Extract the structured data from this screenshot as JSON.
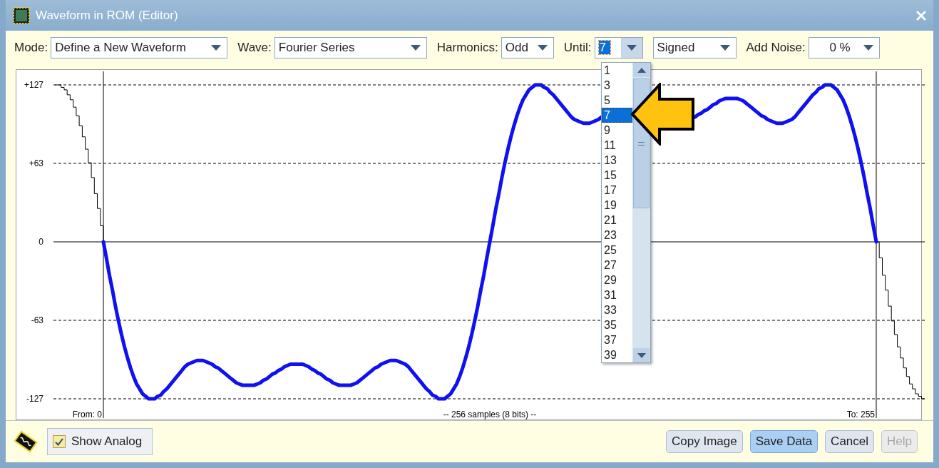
{
  "window": {
    "title": "Waveform in ROM (Editor)"
  },
  "toolbar": {
    "fields": [
      {
        "label": "Mode:",
        "value": "Define a New Waveform",
        "focused": false
      },
      {
        "label": "Wave:",
        "value": "Fourier Series",
        "focused": false
      },
      {
        "label": "Harmonics:",
        "value": "Odd",
        "focused": false
      },
      {
        "label": "Until:",
        "value": "7",
        "focused": true,
        "options": [
          {
            "label": "1",
            "selected": false
          },
          {
            "label": "3",
            "selected": false
          },
          {
            "label": "5",
            "selected": false
          },
          {
            "label": "7",
            "selected": true
          },
          {
            "label": "9",
            "selected": false
          },
          {
            "label": "11",
            "selected": false
          },
          {
            "label": "13",
            "selected": false
          },
          {
            "label": "15",
            "selected": false
          },
          {
            "label": "17",
            "selected": false
          },
          {
            "label": "19",
            "selected": false
          },
          {
            "label": "21",
            "selected": false
          },
          {
            "label": "23",
            "selected": false
          },
          {
            "label": "25",
            "selected": false
          },
          {
            "label": "27",
            "selected": false
          },
          {
            "label": "29",
            "selected": false
          },
          {
            "label": "31",
            "selected": false
          },
          {
            "label": "33",
            "selected": false
          },
          {
            "label": "35",
            "selected": false
          },
          {
            "label": "37",
            "selected": false
          },
          {
            "label": "39",
            "selected": false
          }
        ]
      },
      {
        "value": "Signed",
        "focused": false
      },
      {
        "label": "Add Noise:",
        "value": "0 %",
        "focused": false
      }
    ]
  },
  "chart": {
    "y_labels": [
      "+127",
      "+63",
      "0",
      "-63",
      "-127"
    ],
    "from_label": "From: 0",
    "samples_label": "-- 256 samples (8 bits) --",
    "to_label": "To: 255"
  },
  "footer": {
    "show_analog": {
      "label": "Show Analog",
      "checked": true
    },
    "buttons": [
      {
        "label": "Copy Image",
        "default": false,
        "disabled": false
      },
      {
        "label": "Save Data",
        "default": true,
        "disabled": false
      },
      {
        "label": "Cancel",
        "default": false,
        "disabled": false
      },
      {
        "label": "Help",
        "default": false,
        "disabled": true
      }
    ]
  }
}
